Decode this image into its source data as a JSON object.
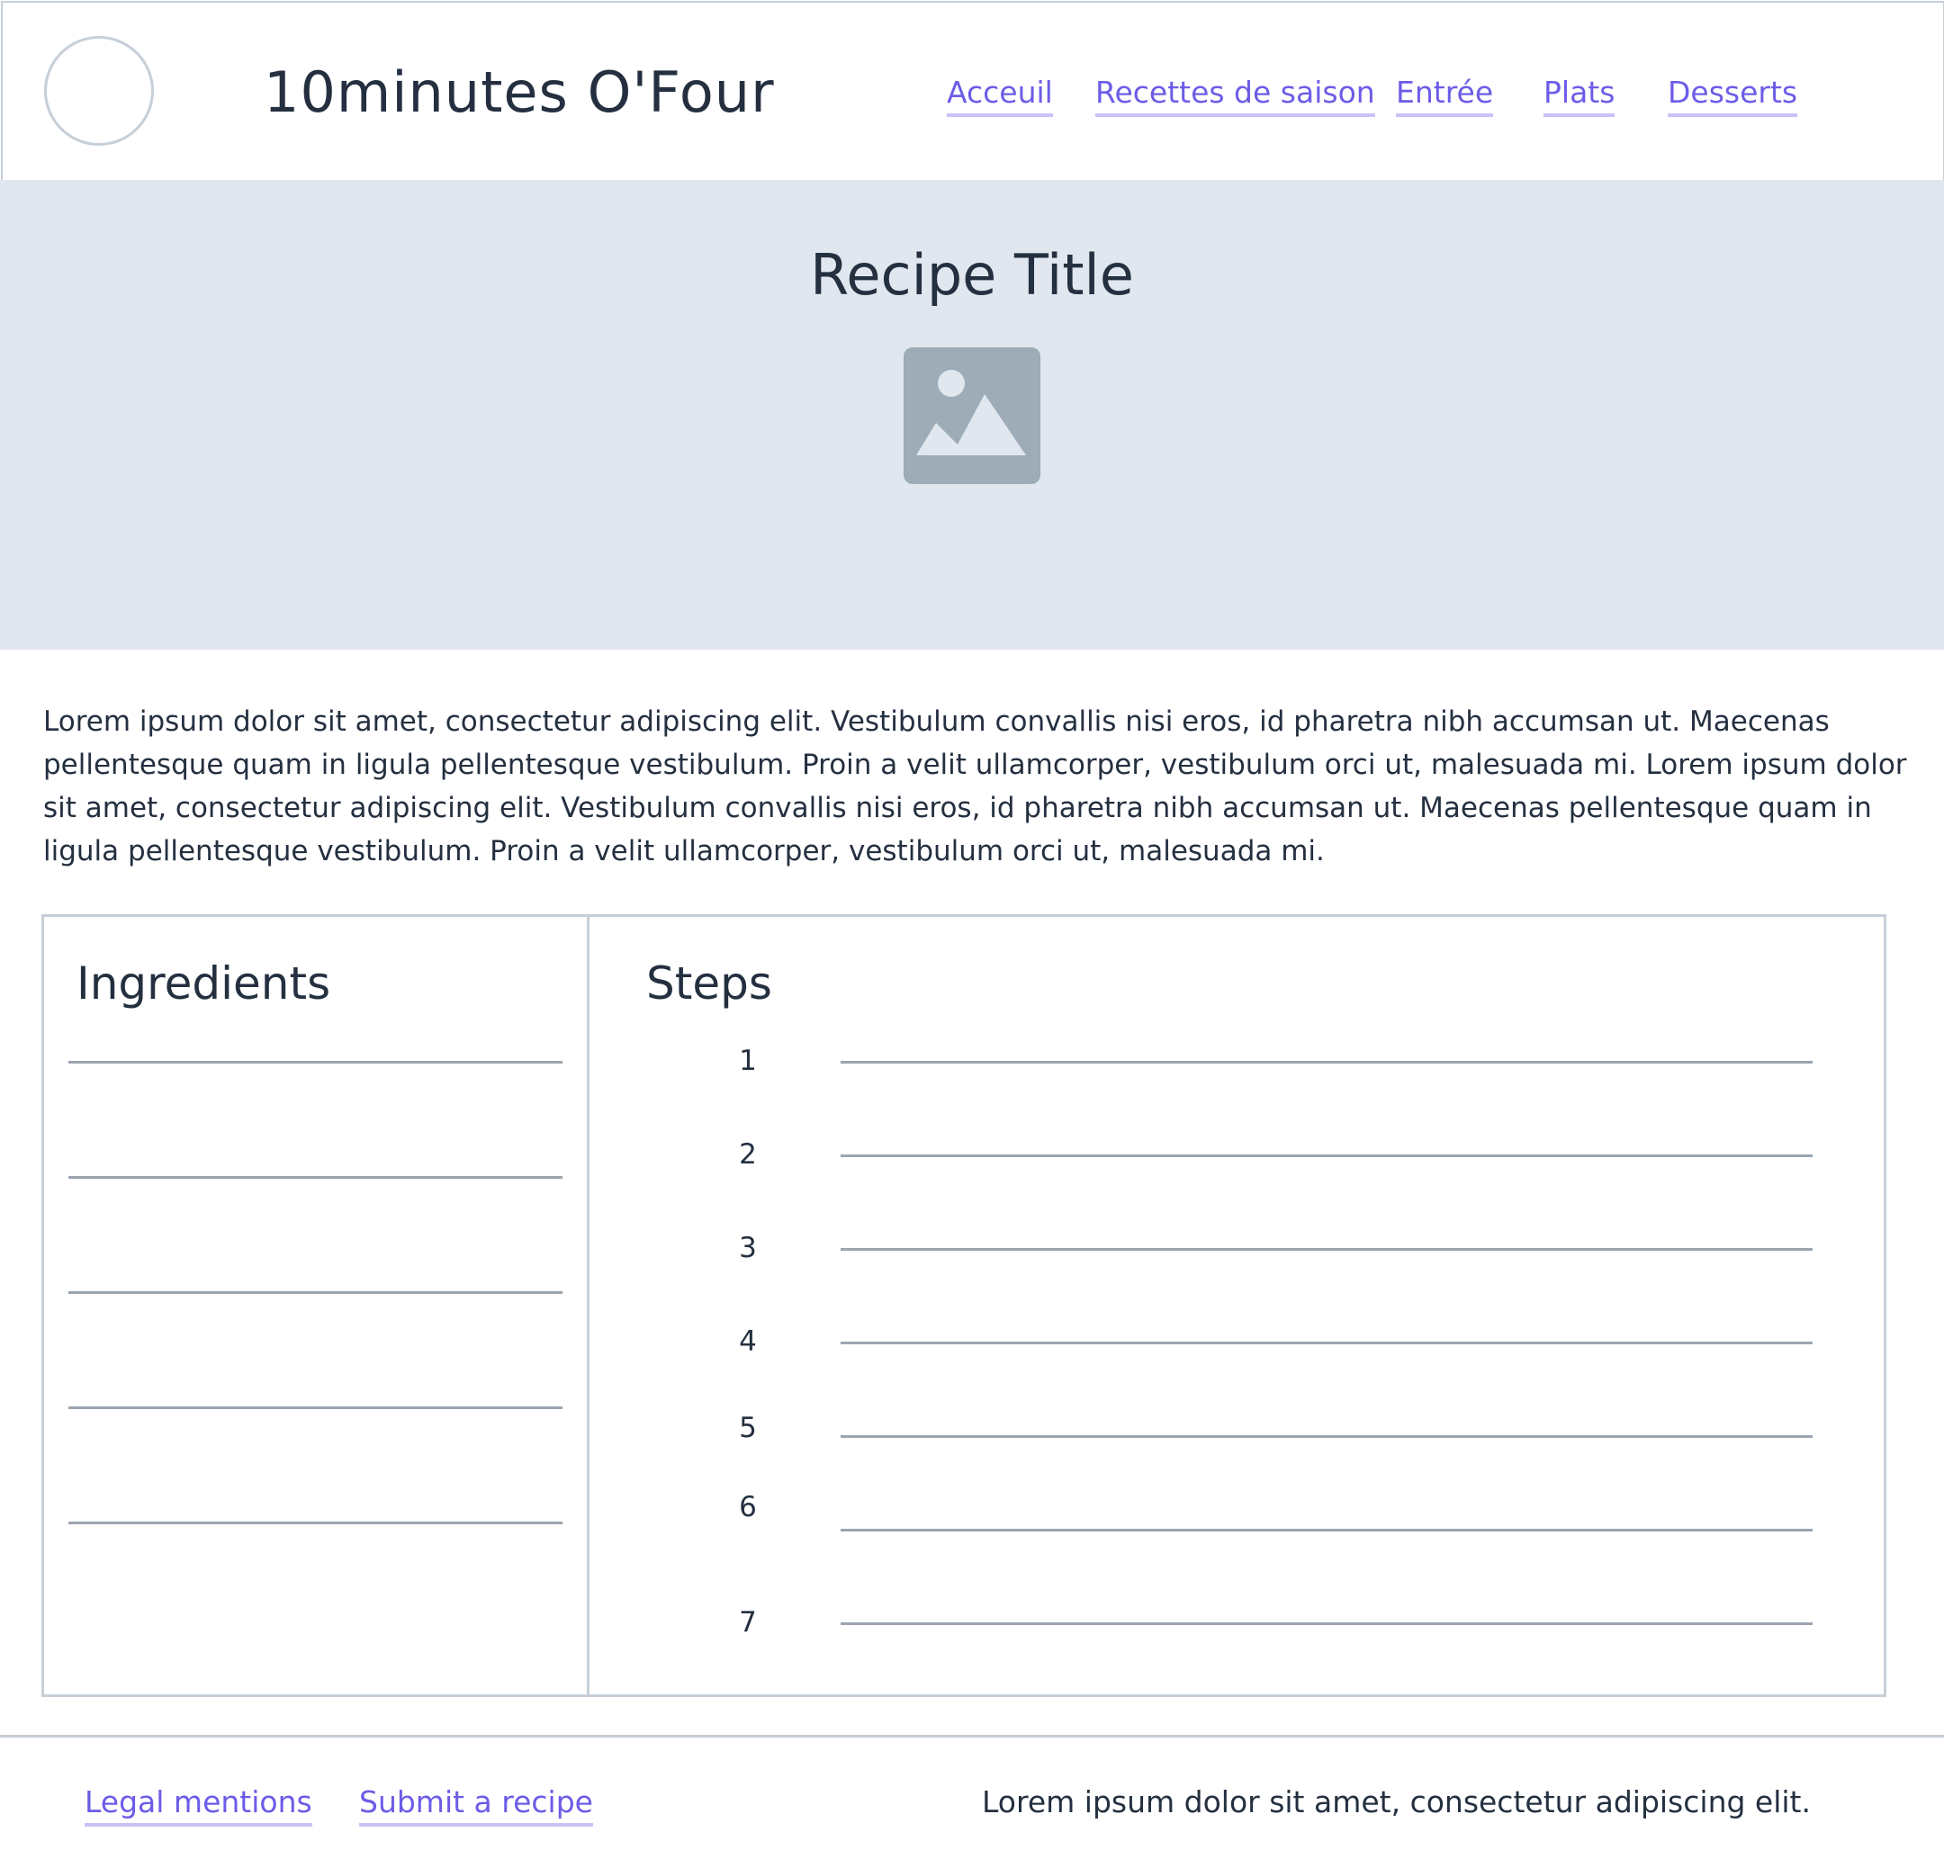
{
  "header": {
    "site_title": "10minutes O'Four",
    "nav": [
      {
        "label": "Acceuil"
      },
      {
        "label": "Recettes de saison"
      },
      {
        "label": "Entrée"
      },
      {
        "label": "Plats"
      },
      {
        "label": "Desserts"
      }
    ]
  },
  "hero": {
    "title": "Recipe Title",
    "image_icon": "image-placeholder-icon"
  },
  "intro": "Lorem ipsum dolor sit amet, consectetur adipiscing elit. Vestibulum convallis nisi eros, id pharetra nibh accumsan ut. Maecenas pellentesque quam in ligula pellentesque vestibulum. Proin a velit ullamcorper, vestibulum orci ut, malesuada mi. Lorem ipsum dolor sit amet, consectetur adipiscing elit. Vestibulum convallis nisi eros, id pharetra nibh accumsan ut. Maecenas pellentesque quam in ligula pellentesque vestibulum. Proin a velit ullamcorper, vestibulum orci ut, malesuada mi.",
  "ingredients": {
    "title": "Ingredients"
  },
  "steps": {
    "title": "Steps",
    "numbers": [
      "1",
      "2",
      "3",
      "4",
      "5",
      "6",
      "7"
    ]
  },
  "footer": {
    "links": [
      {
        "label": "Legal mentions"
      },
      {
        "label": "Submit a recipe"
      }
    ],
    "text": "Lorem ipsum dolor sit amet, consectetur adipiscing elit."
  },
  "colors": {
    "link": "#6c5ce7",
    "hero_background": "#e1e7ef",
    "text": "#243040",
    "border": "#c6cfd8"
  }
}
